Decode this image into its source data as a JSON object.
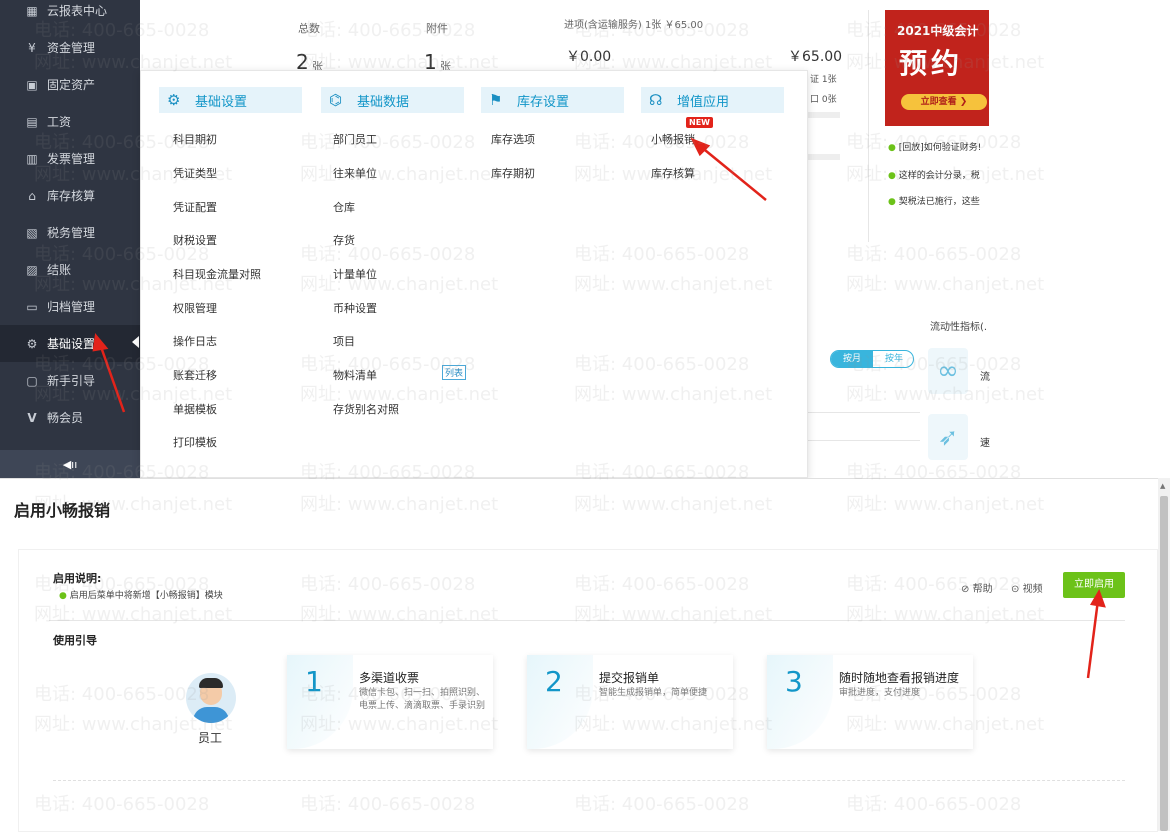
{
  "sidebar": {
    "items": [
      {
        "label": "云报表中心",
        "icon": "chart-icon"
      },
      {
        "label": "资金管理",
        "icon": "money-icon"
      },
      {
        "label": "固定资产",
        "icon": "asset-icon"
      },
      {
        "label": "工资",
        "icon": "salary-icon"
      },
      {
        "label": "发票管理",
        "icon": "invoice-icon"
      },
      {
        "label": "库存核算",
        "icon": "warehouse-icon"
      },
      {
        "label": "税务管理",
        "icon": "tax-icon"
      },
      {
        "label": "结账",
        "icon": "close-account-icon"
      },
      {
        "label": "归档管理",
        "icon": "archive-icon"
      },
      {
        "label": "基础设置",
        "icon": "gear-icon"
      },
      {
        "label": "新手引导",
        "icon": "guide-icon"
      },
      {
        "label": "畅会员",
        "icon": "vip-icon"
      }
    ],
    "active_index": 9
  },
  "dashboard": {
    "total_label": "总数",
    "total_value": "2",
    "total_unit": "张",
    "attach_label": "附件",
    "attach_value": "1",
    "attach_unit": "张",
    "tax_label": "进项(含运输服务) 1张 ￥65.00",
    "amount_left": "￥0.00",
    "amount_right": "￥65.00",
    "side_count_1": "证 1张",
    "side_count_2": "口 0张",
    "news": [
      "[回放]如何验证财务!",
      "这样的会计分录，税",
      "契税法已施行，这些"
    ],
    "toggle_month": "按月",
    "toggle_year": "按年",
    "liquidity_label": "流动性指标(.",
    "liq_item_1": "流",
    "liq_item_2": "速"
  },
  "ad": {
    "line1": "2021中级会计",
    "line2": "预约",
    "button": "立即查看 ❯"
  },
  "menu": {
    "columns": [
      {
        "title": "基础设置",
        "items": [
          "科目期初",
          "凭证类型",
          "凭证配置",
          "财税设置",
          "科目现金流量对照",
          "权限管理",
          "操作日志",
          "账套迁移",
          "单据模板",
          "打印模板"
        ]
      },
      {
        "title": "基础数据",
        "items": [
          "部门员工",
          "往来单位",
          "仓库",
          "存货",
          "计量单位",
          "币种设置",
          "项目",
          "物料清单",
          "存货别名对照"
        ]
      },
      {
        "title": "库存设置",
        "items": [
          "库存选项",
          "库存期初"
        ]
      },
      {
        "title": "增值应用",
        "items": [
          "小畅报销",
          "库存核算"
        ]
      }
    ],
    "new_badge": "NEW",
    "list_tag": "列表"
  },
  "bottom": {
    "title": "启用小畅报销",
    "desc_title": "启用说明:",
    "desc_item": "启用后菜单中将新增【小畅报销】模块",
    "help": "帮助",
    "video": "视频",
    "enable_button": "立即启用",
    "guide_title": "使用引导",
    "role": "员工",
    "steps": [
      {
        "num": "1",
        "title": "多渠道收票",
        "desc": "微信卡包、扫一扫、拍照识别、电票上传、滴滴取票、手录识别"
      },
      {
        "num": "2",
        "title": "提交报销单",
        "desc": "智能生成报销单，简单便捷"
      },
      {
        "num": "3",
        "title": "随时随地查看报销进度",
        "desc": "审批进度，支付进度"
      }
    ]
  },
  "watermark": {
    "phone": "电话: 400-665-0028",
    "site": "网址: www.chanjet.net"
  },
  "colors": {
    "sidebar_bg": "#2f3542",
    "accent_blue": "#1296c8",
    "enable_green": "#6cc219",
    "arrow_red": "#e2231a"
  }
}
